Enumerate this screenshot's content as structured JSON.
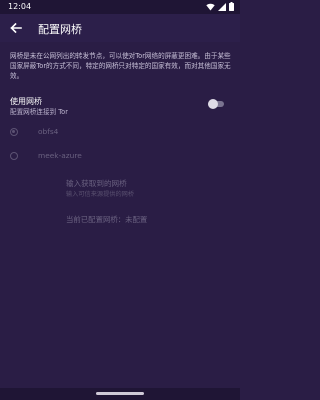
{
  "status_bar": {
    "time": "12:04"
  },
  "app_bar": {
    "title": "配置网桥"
  },
  "description": "网桥是未在公网列出的转发节点，可以使对Tor网络的屏蔽更困难。由于某些国家屏蔽Tor的方式不同，特定的网桥只对特定的国家有效，而对其他国家无效。",
  "use_bridges": {
    "title": "使用网桥",
    "subtitle": "配置网桥连接到 Tor",
    "enabled": false
  },
  "bridge_options": [
    {
      "label": "obfs4",
      "selected": true
    },
    {
      "label": "meek-azure",
      "selected": false
    }
  ],
  "custom_bridge": {
    "title": "输入获取到的网桥",
    "subtitle": "输入可信来源提供的网桥"
  },
  "current_bridge": "当前已配置网桥：未配置",
  "colors": {
    "background": "#2a1d45",
    "app_bar": "#2c1f4a",
    "disabled_text": "#6a6180"
  }
}
